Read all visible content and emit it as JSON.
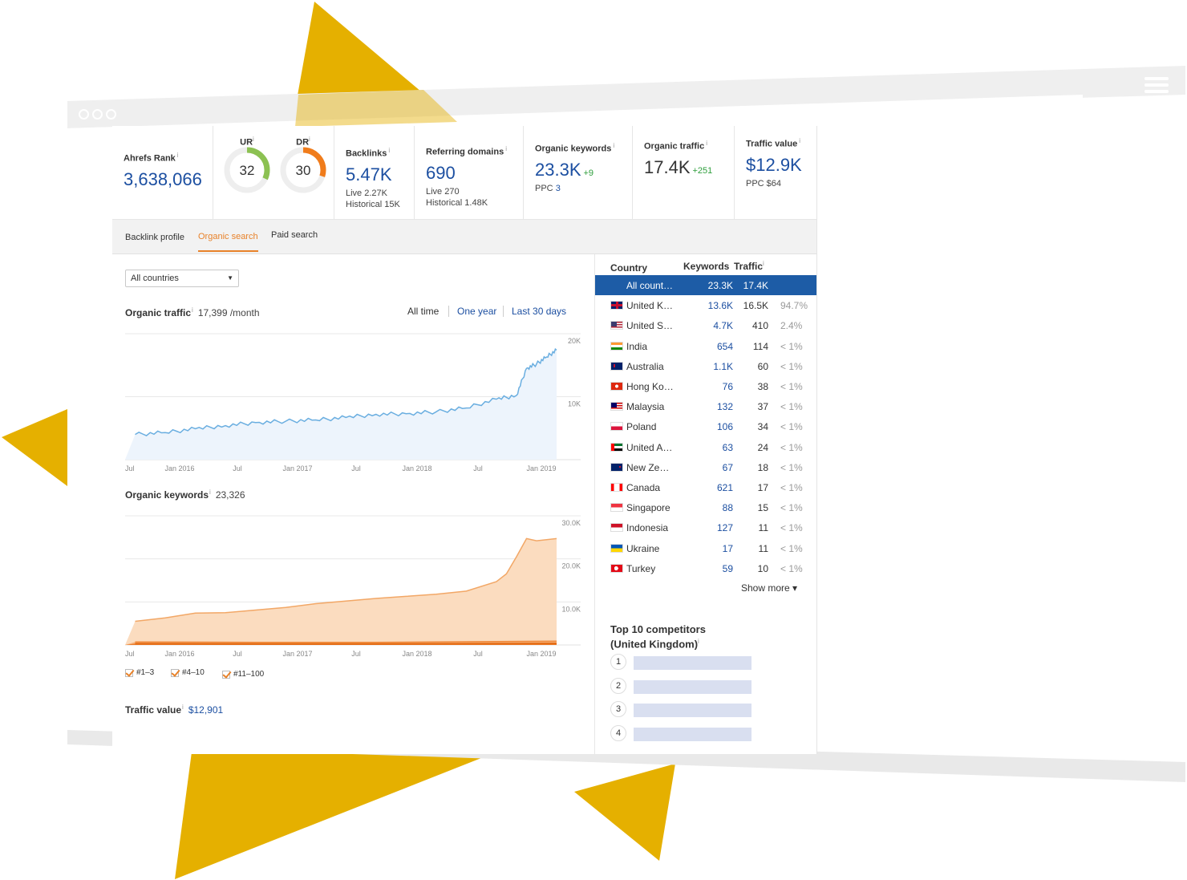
{
  "colors": {
    "accent_blue": "#1c4fa1",
    "accent_orange": "#e8822a",
    "positive_green": "#2e9e3c",
    "decor_yellow": "#e5b000",
    "selected_row": "#1d5ca6"
  },
  "icons": {
    "window_dots": "three-circle-dots-icon",
    "menu": "hamburger-menu-icon",
    "dropdown": "caret-down-icon"
  },
  "metrics": {
    "ahrefs_rank": {
      "label": "Ahrefs Rank",
      "value": "3,638,066"
    },
    "ur": {
      "label": "UR",
      "value": "32",
      "score": 32
    },
    "dr": {
      "label": "DR",
      "value": "30",
      "score": 30
    },
    "backlinks": {
      "label": "Backlinks",
      "value": "5.47K",
      "live": "Live 2.27K",
      "historical": "Historical 15K"
    },
    "referring_domains": {
      "label": "Referring domains",
      "value": "690",
      "live": "Live 270",
      "historical": "Historical 1.48K"
    },
    "organic_keywords": {
      "label": "Organic keywords",
      "value": "23.3K",
      "delta": "+9",
      "ppc_label": "PPC",
      "ppc_value": "3"
    },
    "organic_traffic": {
      "label": "Organic traffic",
      "value": "17.4K",
      "delta": "+251"
    },
    "traffic_value": {
      "label": "Traffic value",
      "value": "$12.9K",
      "ppc": "PPC $64"
    }
  },
  "info_mark": "i",
  "tabs": [
    {
      "label": "Backlink profile",
      "active": false
    },
    {
      "label": "Organic search",
      "active": true
    },
    {
      "label": "Paid search",
      "active": false
    }
  ],
  "filter": {
    "selected": "All countries"
  },
  "organic_traffic_section": {
    "title": "Organic traffic",
    "value": "17,399 /month",
    "ranges": [
      "All time",
      "One year",
      "Last 30 days"
    ],
    "active_range": "All time"
  },
  "organic_keywords_section": {
    "title": "Organic keywords",
    "value": "23,326",
    "legend": [
      "#1–3",
      "#4–10",
      "#11–100"
    ]
  },
  "traffic_value_section": {
    "title": "Traffic value",
    "value": "$12,901"
  },
  "chart_data": [
    {
      "type": "area",
      "x_tick_labels": [
        "Jul",
        "Jan 2016",
        "Jul",
        "Jan 2017",
        "Jul",
        "Jan 2018",
        "Jul",
        "Jan 2019"
      ],
      "y_tick_labels": [
        "10K",
        "20K"
      ],
      "ylim": [
        0,
        20000
      ],
      "grid": true,
      "series": [
        {
          "x": [
            "2015-07",
            "2015-10",
            "2016-01",
            "2016-04",
            "2016-07",
            "2016-10",
            "2017-01",
            "2017-04",
            "2017-07",
            "2017-10",
            "2018-01",
            "2018-04",
            "2018-07",
            "2018-09",
            "2018-10",
            "2018-11",
            "2018-12",
            "2019-01"
          ],
          "values": [
            4000,
            4300,
            4900,
            5400,
            5900,
            6100,
            6300,
            6700,
            7200,
            7300,
            7600,
            8200,
            9600,
            10200,
            14500,
            15200,
            16300,
            17400
          ]
        }
      ]
    },
    {
      "type": "area",
      "x_tick_labels": [
        "Jul",
        "Jan 2016",
        "Jul",
        "Jan 2017",
        "Jul",
        "Jan 2018",
        "Jul",
        "Jan 2019"
      ],
      "y_tick_labels": [
        "10.0K",
        "20.0K",
        "30.0K"
      ],
      "ylim": [
        0,
        30000
      ],
      "grid": true,
      "series": [
        {
          "name": "#11–100",
          "x": [
            "2015-07",
            "2015-10",
            "2016-01",
            "2016-04",
            "2016-07",
            "2016-10",
            "2017-01",
            "2017-04",
            "2017-07",
            "2017-10",
            "2018-01",
            "2018-04",
            "2018-07",
            "2018-08",
            "2018-09",
            "2018-10",
            "2018-11",
            "2019-01"
          ],
          "values": [
            5500,
            6300,
            7400,
            7500,
            8100,
            8700,
            9600,
            10200,
            10800,
            11300,
            11800,
            12500,
            14700,
            16500,
            20500,
            24700,
            24200,
            24700
          ]
        },
        {
          "name": "#4–10",
          "x": [
            "2015-07",
            "2016-07",
            "2017-07",
            "2018-07",
            "2019-01"
          ],
          "values": [
            700,
            600,
            600,
            800,
            900
          ]
        },
        {
          "name": "#1–3",
          "x": [
            "2015-07",
            "2016-07",
            "2017-07",
            "2018-07",
            "2019-01"
          ],
          "values": [
            300,
            250,
            250,
            300,
            350
          ]
        }
      ]
    }
  ],
  "countries_table": {
    "headers": {
      "country": "Country",
      "keywords": "Keywords",
      "traffic": "Traffic"
    },
    "rows": [
      {
        "country": "All count…",
        "keywords": "23.3K",
        "traffic": "17.4K",
        "pct": "",
        "flag": "none",
        "selected": true
      },
      {
        "country": "United K…",
        "keywords": "13.6K",
        "traffic": "16.5K",
        "pct": "94.7%",
        "flag": "gb-flag"
      },
      {
        "country": "United S…",
        "keywords": "4.7K",
        "traffic": "410",
        "pct": "2.4%",
        "flag": "us-flag"
      },
      {
        "country": "India",
        "keywords": "654",
        "traffic": "114",
        "pct": "< 1%",
        "flag": "in-flag"
      },
      {
        "country": "Australia",
        "keywords": "1.1K",
        "traffic": "60",
        "pct": "< 1%",
        "flag": "au-flag"
      },
      {
        "country": "Hong Ko…",
        "keywords": "76",
        "traffic": "38",
        "pct": "< 1%",
        "flag": "hk-flag"
      },
      {
        "country": "Malaysia",
        "keywords": "132",
        "traffic": "37",
        "pct": "< 1%",
        "flag": "my-flag"
      },
      {
        "country": "Poland",
        "keywords": "106",
        "traffic": "34",
        "pct": "< 1%",
        "flag": "pl-flag"
      },
      {
        "country": "United A…",
        "keywords": "63",
        "traffic": "24",
        "pct": "< 1%",
        "flag": "ae-flag"
      },
      {
        "country": "New Ze…",
        "keywords": "67",
        "traffic": "18",
        "pct": "< 1%",
        "flag": "nz-flag"
      },
      {
        "country": "Canada",
        "keywords": "621",
        "traffic": "17",
        "pct": "< 1%",
        "flag": "ca-flag"
      },
      {
        "country": "Singapore",
        "keywords": "88",
        "traffic": "15",
        "pct": "< 1%",
        "flag": "sg-flag"
      },
      {
        "country": "Indonesia",
        "keywords": "127",
        "traffic": "11",
        "pct": "< 1%",
        "flag": "id-flag"
      },
      {
        "country": "Ukraine",
        "keywords": "17",
        "traffic": "11",
        "pct": "< 1%",
        "flag": "ua-flag"
      },
      {
        "country": "Turkey",
        "keywords": "59",
        "traffic": "10",
        "pct": "< 1%",
        "flag": "tr-flag"
      }
    ],
    "show_more": "Show more ▾"
  },
  "competitors": {
    "title_line1": "Top 10 competitors",
    "title_line2": "(United Kingdom)",
    "ranks": [
      "1",
      "2",
      "3",
      "4"
    ]
  }
}
